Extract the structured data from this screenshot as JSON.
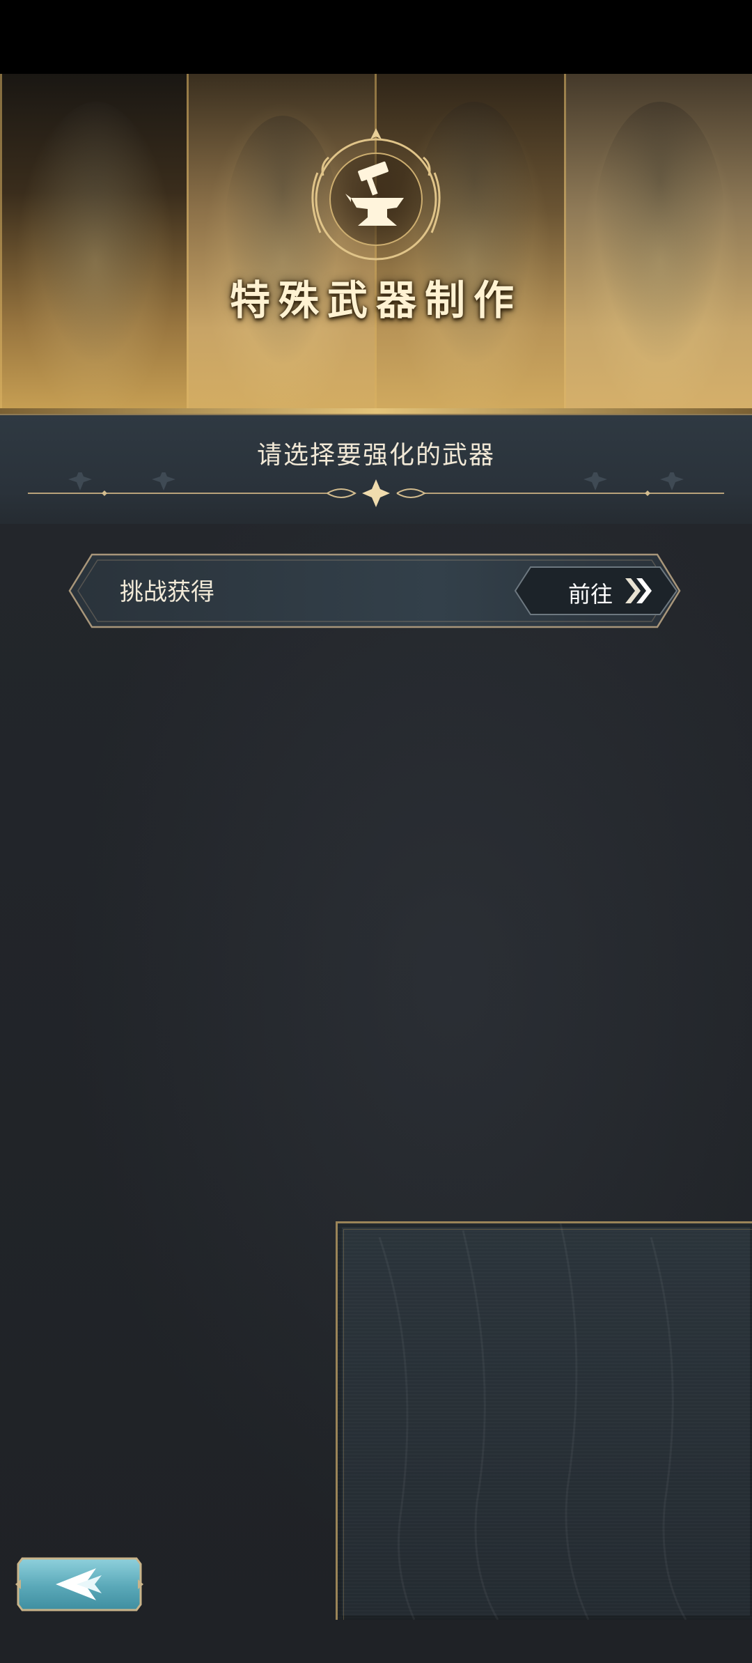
{
  "header": {
    "title": "特殊武器制作",
    "emblem_icon": "anvil-icon"
  },
  "subheader": {
    "title": "请选择要强化的武器"
  },
  "obtain": {
    "label": "挑战获得",
    "goto_label": "前往",
    "goto_icon": "double-chevron-right-icon"
  },
  "back": {
    "icon": "back-arrow-icon"
  },
  "colors": {
    "gold": "#d8b66c",
    "text_light": "#f2ead8",
    "panel_dark": "#1f2227",
    "accent_teal": "#6fb6c6"
  }
}
